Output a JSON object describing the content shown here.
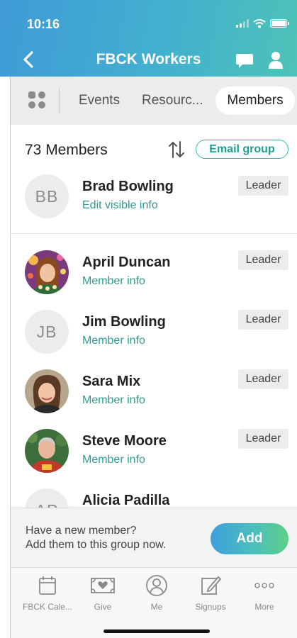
{
  "status_bar": {
    "time": "10:16"
  },
  "nav": {
    "title": "FBCK Workers"
  },
  "tabs": [
    {
      "label": "Events"
    },
    {
      "label": "Resourc..."
    },
    {
      "label": "Members",
      "selected": true
    }
  ],
  "members_header": {
    "count": "73 Members",
    "email_group": "Email group"
  },
  "self_member": {
    "name": "Brad Bowling",
    "initials": "BB",
    "link": "Edit visible info",
    "badge": "Leader"
  },
  "members": [
    {
      "name": "April Duncan",
      "link": "Member info",
      "badge": "Leader",
      "avatar": "photo"
    },
    {
      "name": "Jim Bowling",
      "initials": "JB",
      "link": "Member info",
      "badge": "Leader",
      "avatar": "initials"
    },
    {
      "name": "Sara Mix",
      "link": "Member info",
      "badge": "Leader",
      "avatar": "photo"
    },
    {
      "name": "Steve Moore",
      "link": "Member info",
      "badge": "Leader",
      "avatar": "photo"
    },
    {
      "name": "Alicia Padilla",
      "initials": "AP",
      "avatar": "initials"
    }
  ],
  "footer": {
    "line1": "Have a new member?",
    "line2": "Add them to this group now.",
    "add": "Add"
  },
  "bottom_nav": [
    {
      "label": "FBCK Cale...",
      "icon": "calendar-icon"
    },
    {
      "label": "Give",
      "icon": "give-icon"
    },
    {
      "label": "Me",
      "icon": "user-circle-icon"
    },
    {
      "label": "Signups",
      "icon": "edit-icon"
    },
    {
      "label": "More",
      "icon": "more-icon"
    }
  ],
  "colors": {
    "accent": "#2a9d8f",
    "header_start": "#3f9bd6",
    "header_end": "#4cc3b7"
  }
}
